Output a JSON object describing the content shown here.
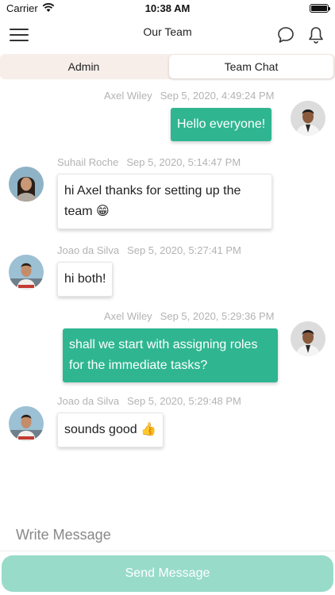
{
  "status_bar": {
    "carrier": "Carrier",
    "time": "10:38 AM"
  },
  "nav": {
    "title": "Our Team",
    "menu_icon": "hamburger-menu-icon",
    "chat_icon": "chat-bubble-icon",
    "bell_icon": "bell-icon"
  },
  "tabs": [
    {
      "label": "Admin",
      "active": false
    },
    {
      "label": "Team Chat",
      "active": true
    }
  ],
  "colors": {
    "outgoing_bubble": "#2fb691",
    "send_button": "#98dbc9",
    "tab_bar": "#f7eeea"
  },
  "messages": [
    {
      "sender": "Axel Wiley",
      "timestamp": "Sep 5, 2020, 4:49:24 PM",
      "text": "Hello everyone!",
      "outgoing": true
    },
    {
      "sender": "Suhail Roche",
      "timestamp": "Sep 5, 2020, 5:14:47 PM",
      "text": "hi Axel thanks for setting up the team 😁",
      "outgoing": false
    },
    {
      "sender": "Joao da Silva",
      "timestamp": "Sep 5, 2020, 5:27:41 PM",
      "text": "hi both!",
      "outgoing": false
    },
    {
      "sender": "Axel Wiley",
      "timestamp": "Sep 5, 2020, 5:29:36 PM",
      "text": "shall we start with assigning roles for the immediate tasks?",
      "outgoing": true
    },
    {
      "sender": "Joao da Silva",
      "timestamp": "Sep 5, 2020, 5:29:48 PM",
      "text": "sounds good 👍",
      "outgoing": false
    }
  ],
  "composer": {
    "placeholder": "Write Message",
    "send_label": "Send Message"
  }
}
